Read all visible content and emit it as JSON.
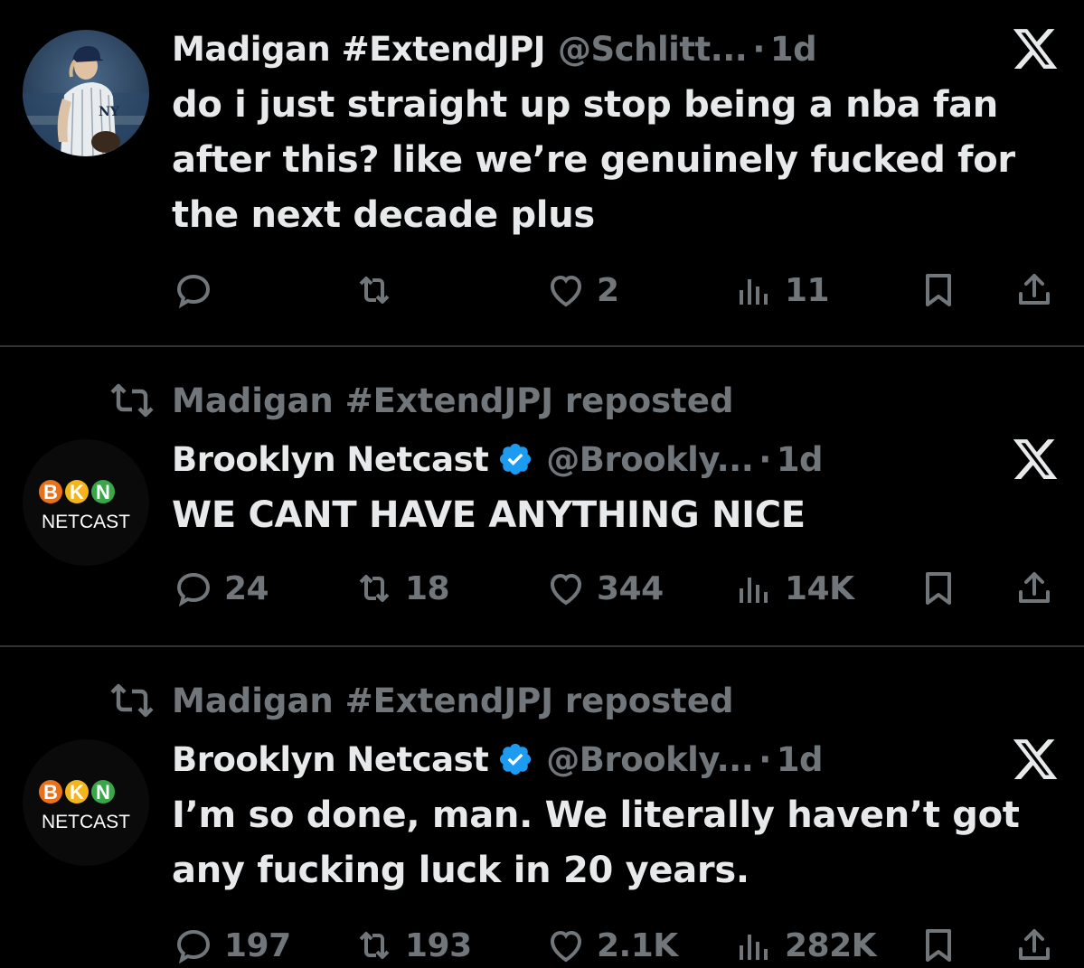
{
  "tweets": [
    {
      "display_name": "Madigan #ExtendJPJ",
      "handle": "@Schlitt...",
      "separator": "·",
      "time": "1d",
      "text": "do i just straight up stop being a nba fan after this? like we’re genuinely fucked for the next decade plus",
      "replies": "",
      "reposts": "",
      "likes": "2",
      "views": "11"
    },
    {
      "repost_label": "Madigan #ExtendJPJ reposted",
      "display_name": "Brooklyn Netcast",
      "handle": "@Brookly...",
      "separator": "·",
      "time": "1d",
      "verified": true,
      "text": "WE CANT HAVE ANYTHING NICE",
      "replies": "24",
      "reposts": "18",
      "likes": "344",
      "views": "14K"
    },
    {
      "repost_label": "Madigan #ExtendJPJ reposted",
      "display_name": "Brooklyn Netcast",
      "handle": "@Brookly...",
      "separator": "·",
      "time": "1d",
      "verified": true,
      "text": "I’m so done, man. We literally haven’t got any fucking luck in 20 years.",
      "replies": "197",
      "reposts": "193",
      "likes": "2.1K",
      "views": "282K"
    }
  ],
  "bkn_logo": {
    "letters": [
      "B",
      "K",
      "N"
    ],
    "subtitle": "NETCAST",
    "colors": [
      "#e8721c",
      "#f2b51c",
      "#3aa64a"
    ]
  },
  "colors": {
    "background": "#000000",
    "text": "#e7e9ea",
    "muted": "#71767b",
    "divider": "#2f3336",
    "verified": "#1d9bf0"
  },
  "icons": [
    "x-logo-icon",
    "reply-icon",
    "repost-icon",
    "like-icon",
    "views-icon",
    "bookmark-icon",
    "share-icon",
    "verified-badge-icon"
  ]
}
